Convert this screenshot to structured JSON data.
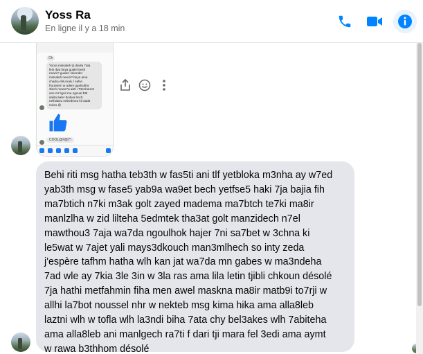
{
  "header": {
    "name": "Yoss Ra",
    "status": "En ligne il y a 18 min"
  },
  "attachment": {
    "mini_ok": "Ok",
    "mini_message": "Yoora missaleh tji dowla 7ata\nlelo tbat heya gualet besh\nnewoi? gualet i skender\nmissaleh newoi? beya ama\nchadou felu kalu / sefwi\nhoussem w adem gualoulha\n3lech mewe7a ab9 i T3echamet\nane mz lguit ma ngoual b9t\nsakta 5aler 8odwa bech\nnethabou nebedmou kil 3ada\nmicro @",
    "mini_reply": "COOL@#@(*\\"
  },
  "message": {
    "text": "Behi riti msg hatha teb3th w fas5ti ani tlf yetbloka m3nha ay w7ed\nyab3th msg w fase5 yab9a wa9et bech yetfse5 haki 7ja bajia fih\nma7btich n7ki m3ak golt zayed madema ma7btch te7ki ma8ir\nmanlzlha w zid lilteha 5edmtek tha3at golt manzidech n7el\nmawthou3 7aja wa7da ngoulhok hajer 7ni sa7bet w 3chna ki\nle5wat w 7ajet yali mays3dkouch man3mlhech so inty zeda\nj'espère tafhm hatha wlh kan jat wa7da mn gabes w ma3ndeha\n7ad wle ay 7kia 3le 3in w 3la ras ama lila letin tjibli chkoun désolé\n7ja hathi metfahmin fiha men awel maskna ma8ir matb9i to7rji w\nallhi la7bot noussel nhr w nekteb msg kima hika ama alla8leb\nlaztni wlh w tofla wlh la3ndi biha 7ata chy bel3akes wlh 7abiteha\nama alla8leb ani manlgech ra7ti f dari tji mara fel 3edi ama aymt\nw rawa b3thhom désolé"
  },
  "colors": {
    "accent": "#0084ff",
    "bubble": "#e4e6eb"
  },
  "icons": [
    "phone-icon",
    "video-camera-icon",
    "info-icon",
    "share-icon",
    "emoji-icon",
    "more-icon",
    "thumbs-up-icon"
  ]
}
